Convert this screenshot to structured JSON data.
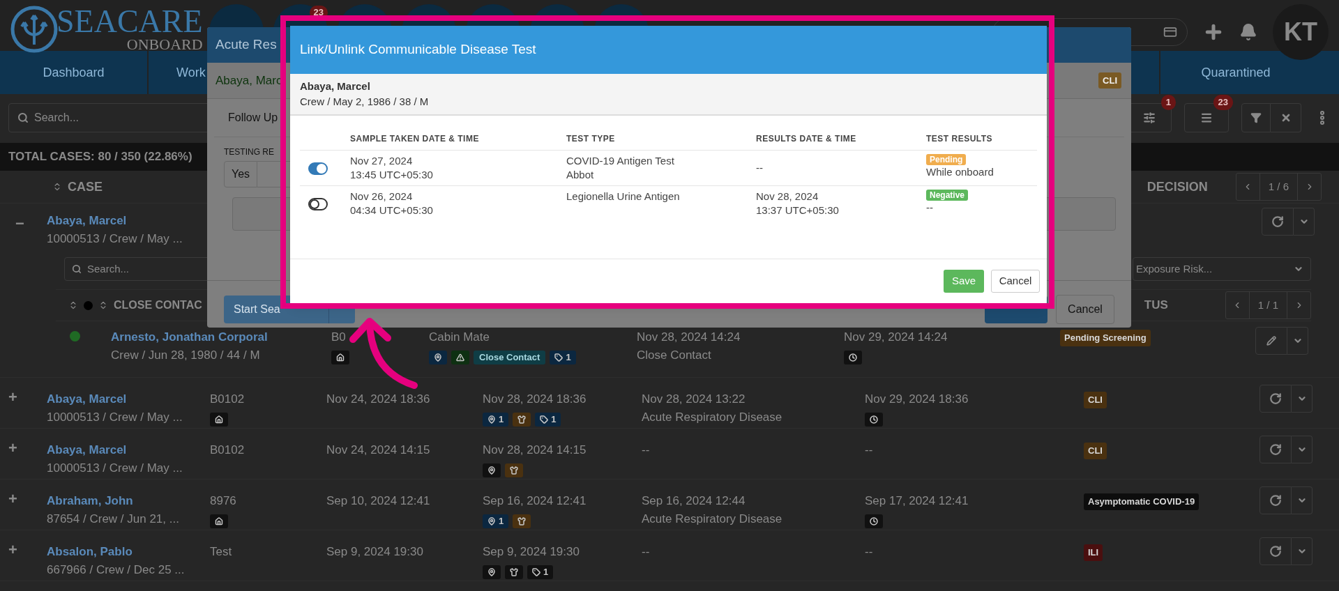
{
  "header": {
    "logo_main": "SEACARE",
    "logo_sub": "ONBOARD",
    "icons": [
      {
        "kind": "plain"
      },
      {
        "kind": "badged",
        "badge": "23"
      },
      {
        "kind": "plain"
      },
      {
        "kind": "plain"
      },
      {
        "kind": "plain"
      },
      {
        "kind": "plain"
      },
      {
        "kind": "plain"
      }
    ],
    "avatar": "KT"
  },
  "nav": [
    {
      "label": "Dashboard"
    },
    {
      "label": "Work"
    },
    {
      "label": "Quarantined"
    }
  ],
  "toolbar": {
    "search_placeholder": "Search...",
    "buttons": [
      {
        "kind": "sliders",
        "badge": "1"
      },
      {
        "kind": "list",
        "badge": "23"
      }
    ]
  },
  "total_cases": "TOTAL CASES: 80 / 350 (22.86%)",
  "case_table": {
    "columns": [
      "CASE",
      "DECISION"
    ],
    "pager": "1 / 6",
    "expanded": {
      "toggle": "−",
      "name": "Abaya, Marcel",
      "meta": "10000513 / Crew / May ...",
      "action": {
        "kind": "refresh"
      },
      "contacts": {
        "search_placeholder": "Search...",
        "exposure_placeholder": "Exposure Risk...",
        "columns": [
          "CLOSE CONTAC",
          "TUS"
        ],
        "pager": "1 / 1",
        "rows": [
          {
            "dot": {
              "color": "#1f6a24"
            },
            "name": "Arnesto, Jonathan Corporal",
            "meta": "Crew / Jun 28, 1980 / 44 / M",
            "cabin": "B0",
            "cabin_badges": [
              {
                "kind": "home",
                "color": "#111111"
              }
            ],
            "relation": "Cabin Mate",
            "badges": [
              {
                "kind": "pin",
                "color": "#0b2740"
              },
              {
                "kind": "warning",
                "color": "#0e3012"
              },
              {
                "kind": "text",
                "text": "Close Contact",
                "color": "#0f3d45"
              },
              {
                "kind": "tag",
                "text": "1",
                "color": "#0b2740"
              }
            ],
            "contact_date": "Nov 28, 2024 14:24",
            "contact_type": "Close Contact",
            "due": "Nov 29, 2024 14:24",
            "due_badges": [
              {
                "kind": "clock",
                "color": "#111111"
              }
            ],
            "status": {
              "text": "Pending Screening",
              "color": "#4a3110"
            },
            "action": {
              "kind": "edit"
            }
          }
        ]
      }
    },
    "rows": [
      {
        "toggle": "+",
        "name": "Abaya, Marcel",
        "meta": "10000513 / Crew / May ...",
        "cabin": "B0102",
        "cabin_badges": [
          {
            "kind": "home",
            "color": "#111111"
          }
        ],
        "onset": "Nov 24, 2024 18:36",
        "reported": "Nov 28, 2024 18:36",
        "reported_badges": [
          {
            "kind": "pin",
            "text": "1",
            "color": "#0b2740"
          },
          {
            "kind": "shirt",
            "color": "#4a3110"
          },
          {
            "kind": "tag",
            "text": "1",
            "color": "#0b2740"
          }
        ],
        "diagnosis": [
          "Nov 28, 2024 13:22",
          "Acute Respiratory Disease"
        ],
        "due": "Nov 29, 2024 18:36",
        "due_badges": [
          {
            "kind": "clock",
            "color": "#111111"
          }
        ],
        "status": {
          "text": "CLI",
          "color": "#4a3110"
        },
        "action": {
          "kind": "refresh"
        }
      },
      {
        "toggle": "+",
        "name": "Abaya, Marcel",
        "meta": "10000513 / Crew / May ...",
        "cabin": "B0102",
        "cabin_badges": [],
        "onset": "Nov 24, 2024 14:15",
        "reported": "Nov 28, 2024 14:15",
        "reported_badges": [
          {
            "kind": "pin",
            "color": "#111111"
          },
          {
            "kind": "shirt",
            "color": "#4a3110"
          }
        ],
        "diagnosis": [
          "--"
        ],
        "due": "--",
        "due_badges": [],
        "status": {
          "text": "CLI",
          "color": "#4a3110"
        },
        "action": {
          "kind": "refresh"
        }
      },
      {
        "toggle": "+",
        "name": "Abraham, John",
        "meta": "87654 / Crew / Jun 21, ...",
        "cabin": "8976",
        "cabin_badges": [
          {
            "kind": "home",
            "color": "#111111"
          }
        ],
        "onset": "Sep 10, 2024 12:41",
        "reported": "Sep 16, 2024 12:41",
        "reported_badges": [
          {
            "kind": "pin",
            "text": "1",
            "color": "#0b2740"
          },
          {
            "kind": "shirt",
            "color": "#4a3110"
          }
        ],
        "diagnosis": [
          "Sep 16, 2024 12:44",
          "Acute Respiratory Disease"
        ],
        "due": "Sep 17, 2024 12:41",
        "due_badges": [
          {
            "kind": "clock",
            "color": "#111111"
          }
        ],
        "status": {
          "text": "Asymptomatic COVID-19",
          "color": "#0d0d0d"
        },
        "action": {
          "kind": "refresh"
        }
      },
      {
        "toggle": "+",
        "name": "Absalon, Pablo",
        "meta": "667966 / Crew / Dec 25 ...",
        "cabin": "Test",
        "cabin_badges": [],
        "onset": "Sep 9, 2024 19:30",
        "reported": "Sep 9, 2024 19:30",
        "reported_badges": [
          {
            "kind": "pin",
            "color": "#111111"
          },
          {
            "kind": "shirt",
            "color": "#111111"
          },
          {
            "kind": "tag",
            "text": "1",
            "color": "#111111"
          }
        ],
        "diagnosis": [
          "--"
        ],
        "due": "--",
        "due_badges": [],
        "status": {
          "text": "ILI",
          "color": "#4a0f0f"
        },
        "action": {
          "kind": "refresh"
        }
      }
    ]
  },
  "case_modal": {
    "title": "Acute Res",
    "patient": "Abaya, Marc",
    "status_badge": "CLI",
    "follow_up": "Follow Up",
    "testing_label": "TESTING RE",
    "testing_option": "Yes",
    "start_button": "Start Sea",
    "cancel_button": "Cancel"
  },
  "test_modal": {
    "title": "Link/Unlink Communicable Disease Test",
    "patient_name": "Abaya, Marcel",
    "patient_meta": "Crew / May 2, 1986 / 38 / M",
    "columns": [
      "SAMPLE TAKEN DATE & TIME",
      "TEST TYPE",
      "RESULTS DATE & TIME",
      "TEST RESULTS"
    ],
    "rows": [
      {
        "on": true,
        "sample": [
          "Nov 27, 2024",
          "13:45 UTC+05:30"
        ],
        "test_type": [
          "COVID-19 Antigen Test",
          "Abbot"
        ],
        "results_date": [
          "--"
        ],
        "result": {
          "text": "Pending",
          "color": "#f0ad4e"
        },
        "result_note": "While onboard"
      },
      {
        "on": false,
        "sample": [
          "Nov 26, 2024",
          "04:34 UTC+05:30"
        ],
        "test_type": [
          "Legionella Urine Antigen"
        ],
        "results_date": [
          "Nov 28, 2024",
          "13:37 UTC+05:30"
        ],
        "result": {
          "text": "Negative",
          "color": "#5cb85c"
        },
        "result_note": "--"
      }
    ],
    "save_button": "Save",
    "cancel_button": "Cancel"
  }
}
